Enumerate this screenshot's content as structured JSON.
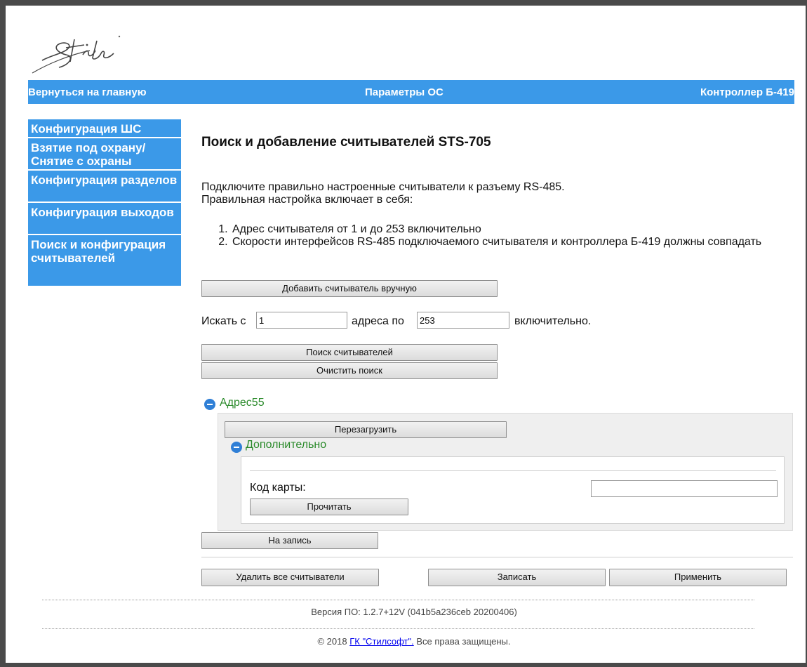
{
  "header": {
    "back_link": "Вернуться на главную",
    "center_title": "Параметры ОС",
    "device": "Контроллер Б-419"
  },
  "sidebar": {
    "items": [
      {
        "label": "Конфигурация ШС"
      },
      {
        "label": "Взятие под охрану/ Снятие с охраны"
      },
      {
        "label": "Конфигурация разделов"
      },
      {
        "label": "Конфигурация выходов"
      },
      {
        "label": "Поиск и конфигурация считывателей"
      }
    ]
  },
  "main": {
    "title": "Поиск и добавление считывателей STS-705",
    "intro_line1": "Подключите правильно настроенные считыватели к разъему RS-485.",
    "intro_line2": "Правильная настройка включает в себя:",
    "requirements": [
      "Адрес считывателя от 1 и до 253 включительно",
      "Скорости интерфейсов RS-485 подключаемого считывателя и контроллера Б-419 должны совпадать"
    ],
    "add_manual_button": "Добавить считыватель вручную",
    "search_from_label": "Искать с",
    "search_from_value": "1",
    "search_to_label": "адреса по",
    "search_to_value": "253",
    "search_suffix": "включительно.",
    "search_button": "Поиск считывателей",
    "clear_button": "Очистить поиск"
  },
  "reader": {
    "title": "Адрес55",
    "reboot_button": "Перезагрузить",
    "advanced_title": "Дополнительно",
    "card_code_label": "Код карты:",
    "card_code_value": "",
    "read_button": "Прочитать",
    "write_button": "На запись"
  },
  "actions": {
    "delete_all": "Удалить все считыватели",
    "write": "Записать",
    "apply": "Применить"
  },
  "footer": {
    "version": "Версия ПО: 1.2.7+12V (041b5a236ceb 20200406)",
    "copyright_prefix": "© 2018 ",
    "company_link": "ГК \"Стилсофт\".",
    "copyright_suffix": " Все права защищены."
  },
  "colors": {
    "accent": "#3b99e8",
    "green": "#2a8a2a",
    "frame": "#4a4a4a"
  }
}
